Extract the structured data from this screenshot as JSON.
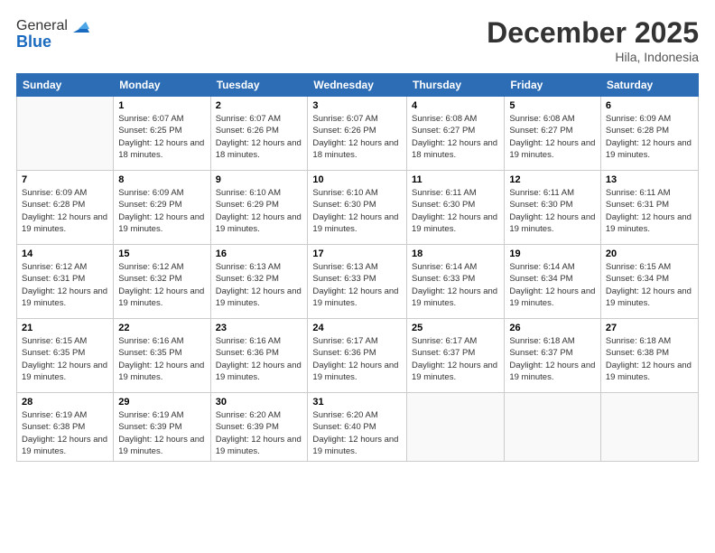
{
  "logo": {
    "general": "General",
    "blue": "Blue"
  },
  "title": "December 2025",
  "location": "Hila, Indonesia",
  "days_header": [
    "Sunday",
    "Monday",
    "Tuesday",
    "Wednesday",
    "Thursday",
    "Friday",
    "Saturday"
  ],
  "weeks": [
    [
      {
        "num": "",
        "sunrise": "",
        "sunset": "",
        "daylight": ""
      },
      {
        "num": "1",
        "sunrise": "Sunrise: 6:07 AM",
        "sunset": "Sunset: 6:25 PM",
        "daylight": "Daylight: 12 hours and 18 minutes."
      },
      {
        "num": "2",
        "sunrise": "Sunrise: 6:07 AM",
        "sunset": "Sunset: 6:26 PM",
        "daylight": "Daylight: 12 hours and 18 minutes."
      },
      {
        "num": "3",
        "sunrise": "Sunrise: 6:07 AM",
        "sunset": "Sunset: 6:26 PM",
        "daylight": "Daylight: 12 hours and 18 minutes."
      },
      {
        "num": "4",
        "sunrise": "Sunrise: 6:08 AM",
        "sunset": "Sunset: 6:27 PM",
        "daylight": "Daylight: 12 hours and 18 minutes."
      },
      {
        "num": "5",
        "sunrise": "Sunrise: 6:08 AM",
        "sunset": "Sunset: 6:27 PM",
        "daylight": "Daylight: 12 hours and 19 minutes."
      },
      {
        "num": "6",
        "sunrise": "Sunrise: 6:09 AM",
        "sunset": "Sunset: 6:28 PM",
        "daylight": "Daylight: 12 hours and 19 minutes."
      }
    ],
    [
      {
        "num": "7",
        "sunrise": "Sunrise: 6:09 AM",
        "sunset": "Sunset: 6:28 PM",
        "daylight": "Daylight: 12 hours and 19 minutes."
      },
      {
        "num": "8",
        "sunrise": "Sunrise: 6:09 AM",
        "sunset": "Sunset: 6:29 PM",
        "daylight": "Daylight: 12 hours and 19 minutes."
      },
      {
        "num": "9",
        "sunrise": "Sunrise: 6:10 AM",
        "sunset": "Sunset: 6:29 PM",
        "daylight": "Daylight: 12 hours and 19 minutes."
      },
      {
        "num": "10",
        "sunrise": "Sunrise: 6:10 AM",
        "sunset": "Sunset: 6:30 PM",
        "daylight": "Daylight: 12 hours and 19 minutes."
      },
      {
        "num": "11",
        "sunrise": "Sunrise: 6:11 AM",
        "sunset": "Sunset: 6:30 PM",
        "daylight": "Daylight: 12 hours and 19 minutes."
      },
      {
        "num": "12",
        "sunrise": "Sunrise: 6:11 AM",
        "sunset": "Sunset: 6:30 PM",
        "daylight": "Daylight: 12 hours and 19 minutes."
      },
      {
        "num": "13",
        "sunrise": "Sunrise: 6:11 AM",
        "sunset": "Sunset: 6:31 PM",
        "daylight": "Daylight: 12 hours and 19 minutes."
      }
    ],
    [
      {
        "num": "14",
        "sunrise": "Sunrise: 6:12 AM",
        "sunset": "Sunset: 6:31 PM",
        "daylight": "Daylight: 12 hours and 19 minutes."
      },
      {
        "num": "15",
        "sunrise": "Sunrise: 6:12 AM",
        "sunset": "Sunset: 6:32 PM",
        "daylight": "Daylight: 12 hours and 19 minutes."
      },
      {
        "num": "16",
        "sunrise": "Sunrise: 6:13 AM",
        "sunset": "Sunset: 6:32 PM",
        "daylight": "Daylight: 12 hours and 19 minutes."
      },
      {
        "num": "17",
        "sunrise": "Sunrise: 6:13 AM",
        "sunset": "Sunset: 6:33 PM",
        "daylight": "Daylight: 12 hours and 19 minutes."
      },
      {
        "num": "18",
        "sunrise": "Sunrise: 6:14 AM",
        "sunset": "Sunset: 6:33 PM",
        "daylight": "Daylight: 12 hours and 19 minutes."
      },
      {
        "num": "19",
        "sunrise": "Sunrise: 6:14 AM",
        "sunset": "Sunset: 6:34 PM",
        "daylight": "Daylight: 12 hours and 19 minutes."
      },
      {
        "num": "20",
        "sunrise": "Sunrise: 6:15 AM",
        "sunset": "Sunset: 6:34 PM",
        "daylight": "Daylight: 12 hours and 19 minutes."
      }
    ],
    [
      {
        "num": "21",
        "sunrise": "Sunrise: 6:15 AM",
        "sunset": "Sunset: 6:35 PM",
        "daylight": "Daylight: 12 hours and 19 minutes."
      },
      {
        "num": "22",
        "sunrise": "Sunrise: 6:16 AM",
        "sunset": "Sunset: 6:35 PM",
        "daylight": "Daylight: 12 hours and 19 minutes."
      },
      {
        "num": "23",
        "sunrise": "Sunrise: 6:16 AM",
        "sunset": "Sunset: 6:36 PM",
        "daylight": "Daylight: 12 hours and 19 minutes."
      },
      {
        "num": "24",
        "sunrise": "Sunrise: 6:17 AM",
        "sunset": "Sunset: 6:36 PM",
        "daylight": "Daylight: 12 hours and 19 minutes."
      },
      {
        "num": "25",
        "sunrise": "Sunrise: 6:17 AM",
        "sunset": "Sunset: 6:37 PM",
        "daylight": "Daylight: 12 hours and 19 minutes."
      },
      {
        "num": "26",
        "sunrise": "Sunrise: 6:18 AM",
        "sunset": "Sunset: 6:37 PM",
        "daylight": "Daylight: 12 hours and 19 minutes."
      },
      {
        "num": "27",
        "sunrise": "Sunrise: 6:18 AM",
        "sunset": "Sunset: 6:38 PM",
        "daylight": "Daylight: 12 hours and 19 minutes."
      }
    ],
    [
      {
        "num": "28",
        "sunrise": "Sunrise: 6:19 AM",
        "sunset": "Sunset: 6:38 PM",
        "daylight": "Daylight: 12 hours and 19 minutes."
      },
      {
        "num": "29",
        "sunrise": "Sunrise: 6:19 AM",
        "sunset": "Sunset: 6:39 PM",
        "daylight": "Daylight: 12 hours and 19 minutes."
      },
      {
        "num": "30",
        "sunrise": "Sunrise: 6:20 AM",
        "sunset": "Sunset: 6:39 PM",
        "daylight": "Daylight: 12 hours and 19 minutes."
      },
      {
        "num": "31",
        "sunrise": "Sunrise: 6:20 AM",
        "sunset": "Sunset: 6:40 PM",
        "daylight": "Daylight: 12 hours and 19 minutes."
      },
      {
        "num": "",
        "sunrise": "",
        "sunset": "",
        "daylight": ""
      },
      {
        "num": "",
        "sunrise": "",
        "sunset": "",
        "daylight": ""
      },
      {
        "num": "",
        "sunrise": "",
        "sunset": "",
        "daylight": ""
      }
    ]
  ]
}
